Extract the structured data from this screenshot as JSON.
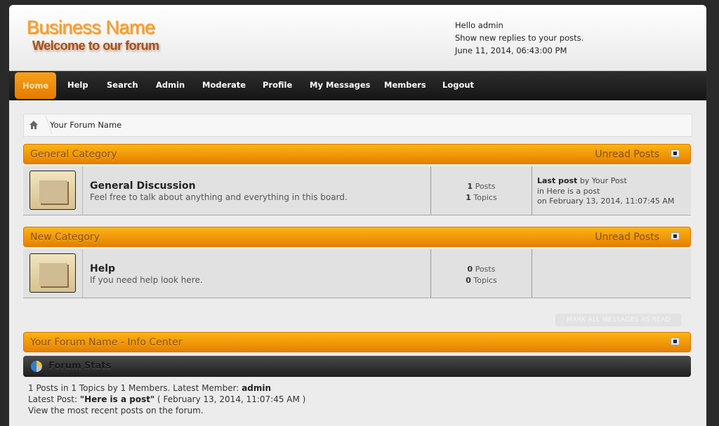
{
  "header": {
    "logo_title": "Business Name",
    "logo_subtitle": "Welcome to our forum",
    "greeting": "Hello admin",
    "new_replies_link": "Show new replies to your posts.",
    "datetime": "June 11, 2014, 06:43:00 PM"
  },
  "nav": {
    "items": [
      {
        "label": "Home",
        "active": true
      },
      {
        "label": "Help"
      },
      {
        "label": "Search"
      },
      {
        "label": "Admin"
      },
      {
        "label": "Moderate"
      },
      {
        "label": "Profile"
      },
      {
        "label": "My Messages"
      },
      {
        "label": "Members"
      },
      {
        "label": "Logout"
      }
    ]
  },
  "breadcrumb": {
    "home_icon": "home-icon",
    "current": "Your Forum Name"
  },
  "categories": [
    {
      "title": "General Category",
      "unread_label": "Unread Posts",
      "boards": [
        {
          "name": "General Discussion",
          "description": "Feel free to talk about anything and everything in this board.",
          "posts_count": "1",
          "posts_label": "Posts",
          "topics_count": "1",
          "topics_label": "Topics",
          "last_post_label": "Last post",
          "last_post_by": "by Your Post",
          "last_post_in": "in Here is a post",
          "last_post_on": "on February 13, 2014, 11:07:45 AM"
        }
      ]
    },
    {
      "title": "New Category",
      "unread_label": "Unread Posts",
      "boards": [
        {
          "name": "Help",
          "description": "If you need help look here.",
          "posts_count": "0",
          "posts_label": "Posts",
          "topics_count": "0",
          "topics_label": "Topics"
        }
      ]
    }
  ],
  "mark_read_button": "MARK ALL MESSAGES AS READ",
  "info_center": {
    "title": "Your Forum Name - Info Center",
    "stats_title": "Forum Stats",
    "stats_line1_prefix": "1 Posts in 1 Topics by 1 Members. Latest Member: ",
    "latest_member": "admin",
    "stats_line2_prefix": "Latest Post: ",
    "latest_post": "\"Here is a post\"",
    "latest_post_date": " ( February 13, 2014, 11:07:45 AM )",
    "recent_posts_link": "View the most recent posts on the forum."
  }
}
